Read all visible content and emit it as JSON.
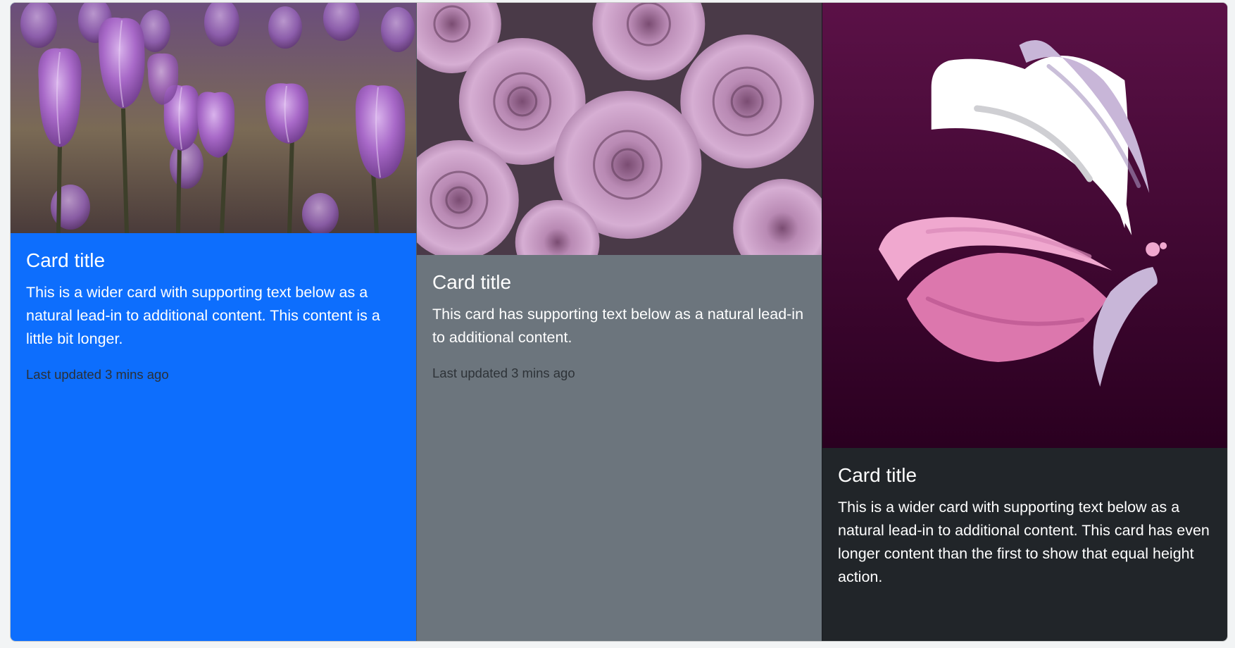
{
  "cards": [
    {
      "image": "purple-tulips-photo",
      "title": "Card title",
      "text": "This is a wider card with supporting text below as a natural lead-in to additional content. This content is a little bit longer.",
      "footer": "Last updated 3 mins ago",
      "background": "#0d6efd"
    },
    {
      "image": "lavender-roses-photo",
      "title": "Card title",
      "text": "This card has supporting text below as a natural lead-in to additional content.",
      "footer": "Last updated 3 mins ago",
      "background": "#6c757d"
    },
    {
      "image": "butterfly-logo",
      "title": "Card title",
      "text": "This is a wider card with supporting text below as a natural lead-in to additional content. This card has even longer content than the first to show that equal height action.",
      "footer": "",
      "background": "#212529"
    }
  ]
}
